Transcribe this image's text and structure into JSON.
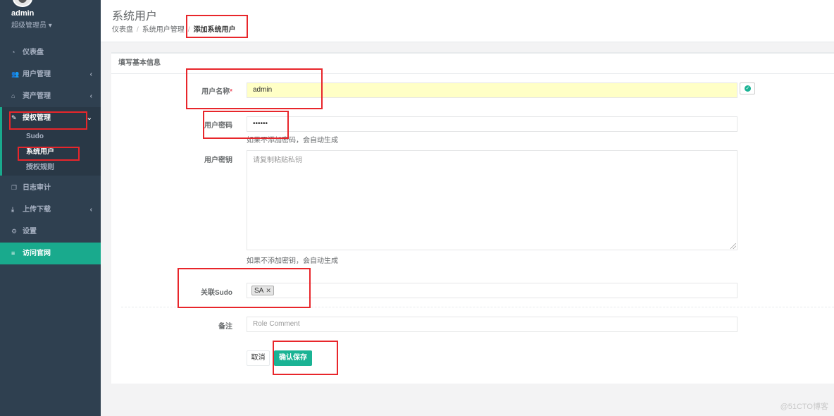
{
  "profile": {
    "name": "admin",
    "role": "超级管理员"
  },
  "sidebar": {
    "items": [
      {
        "label": "仪表盘",
        "icon": "dashboard-icon"
      },
      {
        "label": "用户管理",
        "icon": "users-icon"
      },
      {
        "label": "资产管理",
        "icon": "inbox-icon"
      },
      {
        "label": "授权管理",
        "icon": "edit-icon"
      },
      {
        "label": "日志审计",
        "icon": "copy-icon"
      },
      {
        "label": "上传下载",
        "icon": "download-icon"
      },
      {
        "label": "设置",
        "icon": "gears-icon"
      },
      {
        "label": "访问官网",
        "icon": "database-icon"
      }
    ],
    "submenu": [
      {
        "label": "Sudo"
      },
      {
        "label": "系统用户"
      },
      {
        "label": "授权规则"
      }
    ]
  },
  "header": {
    "title": "系统用户",
    "breadcrumb": [
      "仪表盘",
      "系统用户管理",
      "添加系统用户"
    ]
  },
  "form": {
    "panel_title": "填写基本信息",
    "username_label": "用户名称",
    "required_mark": "*",
    "username_value": "admin",
    "password_label": "用户密码",
    "password_value": "••••••",
    "password_help": "如果不添加密码，会自动生成",
    "key_label": "用户密钥",
    "key_placeholder": "请复制粘贴私钥",
    "key_help": "如果不添加密钥，会自动生成",
    "sudo_label": "关联Sudo",
    "sudo_tag": "SA",
    "comment_label": "备注",
    "comment_placeholder": "Role Comment",
    "cancel_label": "取消",
    "save_label": "确认保存"
  },
  "watermark": "@51CTO博客",
  "colors": {
    "sidebar_bg": "#2f4050",
    "accent": "#1ab394",
    "annotation_red": "#e8262b"
  }
}
